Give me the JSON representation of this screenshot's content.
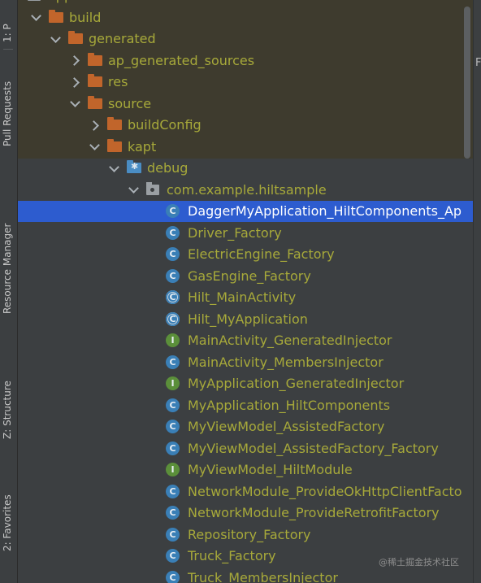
{
  "sidebar_tabs": {
    "project": "1: P",
    "pull_requests": "Pull Requests",
    "resource_manager": "Resource Manager",
    "structure": "Z: Structure",
    "favorites": "2: Favorites"
  },
  "tree": {
    "top_clipped": "app",
    "rows": [
      {
        "label": "build",
        "kind": "folder",
        "arrow": "down"
      },
      {
        "label": "generated",
        "kind": "folder",
        "arrow": "down"
      },
      {
        "label": "ap_generated_sources",
        "kind": "folder",
        "arrow": "right"
      },
      {
        "label": "res",
        "kind": "folder",
        "arrow": "right"
      },
      {
        "label": "source",
        "kind": "folder",
        "arrow": "down"
      },
      {
        "label": "buildConfig",
        "kind": "folder",
        "arrow": "right"
      },
      {
        "label": "kapt",
        "kind": "folder",
        "arrow": "down"
      },
      {
        "label": "debug",
        "kind": "source-folder",
        "arrow": "down"
      },
      {
        "label": "com.example.hiltsample",
        "kind": "package",
        "arrow": "down"
      },
      {
        "label": "DaggerMyApplication_HiltComponents_Ap",
        "kind": "class",
        "selected": true
      },
      {
        "label": "Driver_Factory",
        "kind": "class"
      },
      {
        "label": "ElectricEngine_Factory",
        "kind": "class"
      },
      {
        "label": "GasEngine_Factory",
        "kind": "class"
      },
      {
        "label": "Hilt_MainActivity",
        "kind": "abstract-class"
      },
      {
        "label": "Hilt_MyApplication",
        "kind": "abstract-class"
      },
      {
        "label": "MainActivity_GeneratedInjector",
        "kind": "interface"
      },
      {
        "label": "MainActivity_MembersInjector",
        "kind": "class"
      },
      {
        "label": "MyApplication_GeneratedInjector",
        "kind": "interface"
      },
      {
        "label": "MyApplication_HiltComponents",
        "kind": "class"
      },
      {
        "label": "MyViewModel_AssistedFactory",
        "kind": "class"
      },
      {
        "label": "MyViewModel_AssistedFactory_Factory",
        "kind": "class"
      },
      {
        "label": "MyViewModel_HiltModule",
        "kind": "interface"
      },
      {
        "label": "NetworkModule_ProvideOkHttpClientFacto",
        "kind": "class"
      },
      {
        "label": "NetworkModule_ProvideRetrofitFactory",
        "kind": "class"
      },
      {
        "label": "Repository_Factory",
        "kind": "class"
      },
      {
        "label": "Truck_Factory",
        "kind": "class"
      },
      {
        "label": "Truck_MembersInjector",
        "kind": "class"
      }
    ]
  },
  "icon_glyphs": {
    "class": "C",
    "interface": "I"
  },
  "right_edge_text": "F",
  "watermark": "@稀土掘金技术社区",
  "colors": {
    "selection": "#2d5ccf",
    "label": "#a7a93a",
    "folder": "#c1652b",
    "class_icon": "#3a7fb6",
    "interface_icon": "#5b8f3a"
  }
}
